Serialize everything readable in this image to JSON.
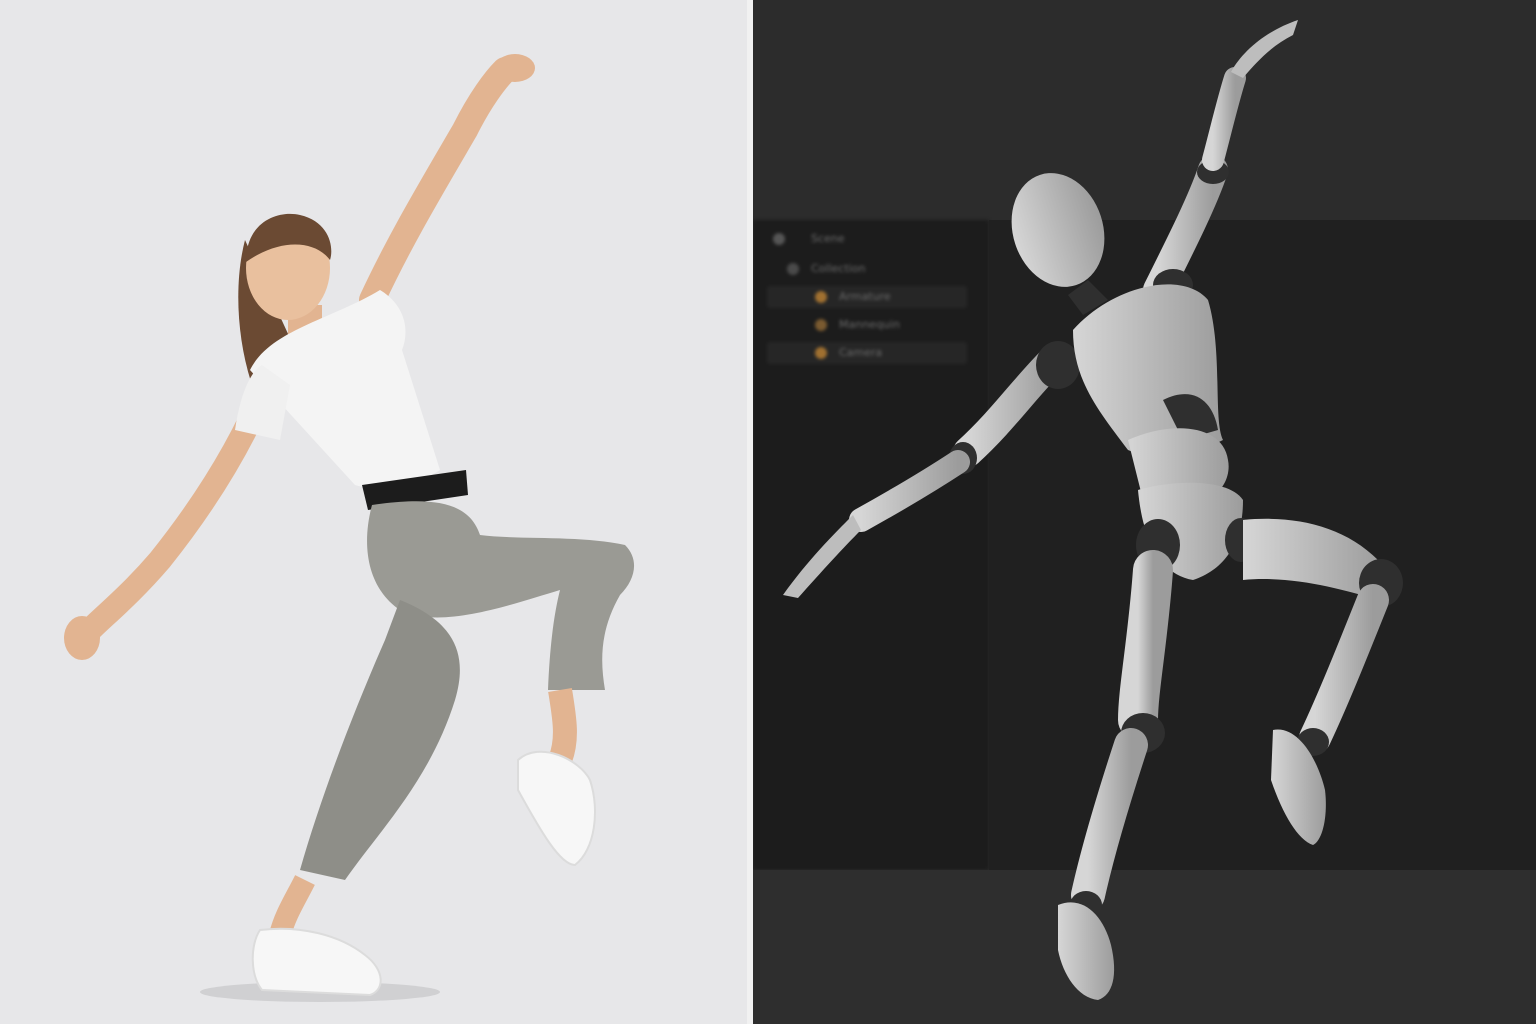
{
  "scene": {
    "left_photo": {
      "subject": "dancer-photo"
    },
    "right_render": {
      "subject": "mannequin-render"
    }
  },
  "outliner": {
    "rows": [
      {
        "label": "Scene",
        "icon": "scene-icon"
      },
      {
        "label": "Collection",
        "icon": "collection-icon"
      },
      {
        "label": "Armature",
        "icon": "armature-icon"
      },
      {
        "label": "Mannequin",
        "icon": "mesh-icon"
      },
      {
        "label": "Camera",
        "icon": "camera-icon"
      }
    ]
  },
  "colors": {
    "left_bg": "#e7e7e9",
    "right_bg": "#2c2c2c",
    "skin": "#e2b491",
    "shirt": "#f4f4f4",
    "jeans": "#9a9a94",
    "mannequin": "#bdbdbd",
    "joint": "#2f2f2f"
  }
}
